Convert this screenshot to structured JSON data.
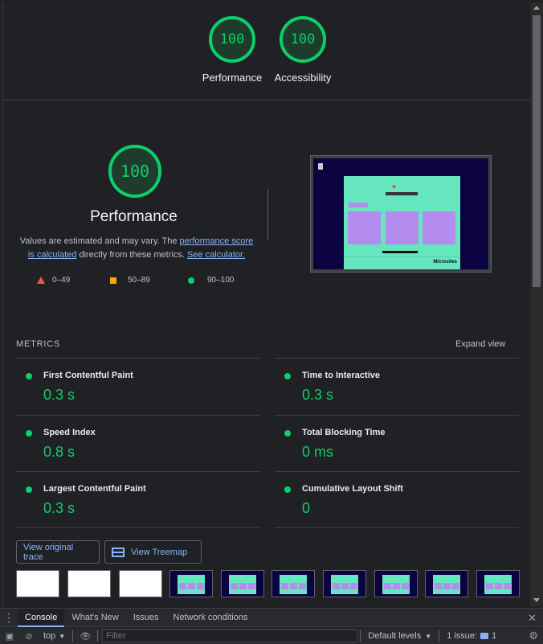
{
  "categories": [
    {
      "score": "100",
      "label": "Performance"
    },
    {
      "score": "100",
      "label": "Accessibility"
    }
  ],
  "performance": {
    "score": "100",
    "title": "Performance",
    "desc_prefix": "Values are estimated and may vary. The ",
    "desc_link1": "performance score is calculated",
    "desc_middle": " directly from these metrics. ",
    "desc_link2": "See calculator.",
    "legend": {
      "fail": "0–49",
      "average": "50–89",
      "pass": "90–100"
    }
  },
  "screenshot": {
    "micro_label": "Microsites"
  },
  "metrics": {
    "heading": "METRICS",
    "expand_label": "Expand view",
    "items": [
      {
        "name": "First Contentful Paint",
        "value": "0.3 s"
      },
      {
        "name": "Time to Interactive",
        "value": "0.3 s"
      },
      {
        "name": "Speed Index",
        "value": "0.8 s"
      },
      {
        "name": "Total Blocking Time",
        "value": "0 ms"
      },
      {
        "name": "Largest Contentful Paint",
        "value": "0.3 s"
      },
      {
        "name": "Cumulative Layout Shift",
        "value": "0"
      }
    ]
  },
  "buttons": {
    "view_trace": "View original trace",
    "view_treemap": "View Treemap"
  },
  "drawer": {
    "tabs": [
      "Console",
      "What's New",
      "Issues",
      "Network conditions"
    ],
    "context": "top",
    "filter_placeholder": "Filter",
    "levels": "Default levels",
    "issues_label": "1 issue:",
    "issues_count": "1"
  },
  "colors": {
    "pass": "#0cce6b",
    "average": "#ffa400",
    "fail": "#ff4e42",
    "link": "#8ab4f8"
  }
}
